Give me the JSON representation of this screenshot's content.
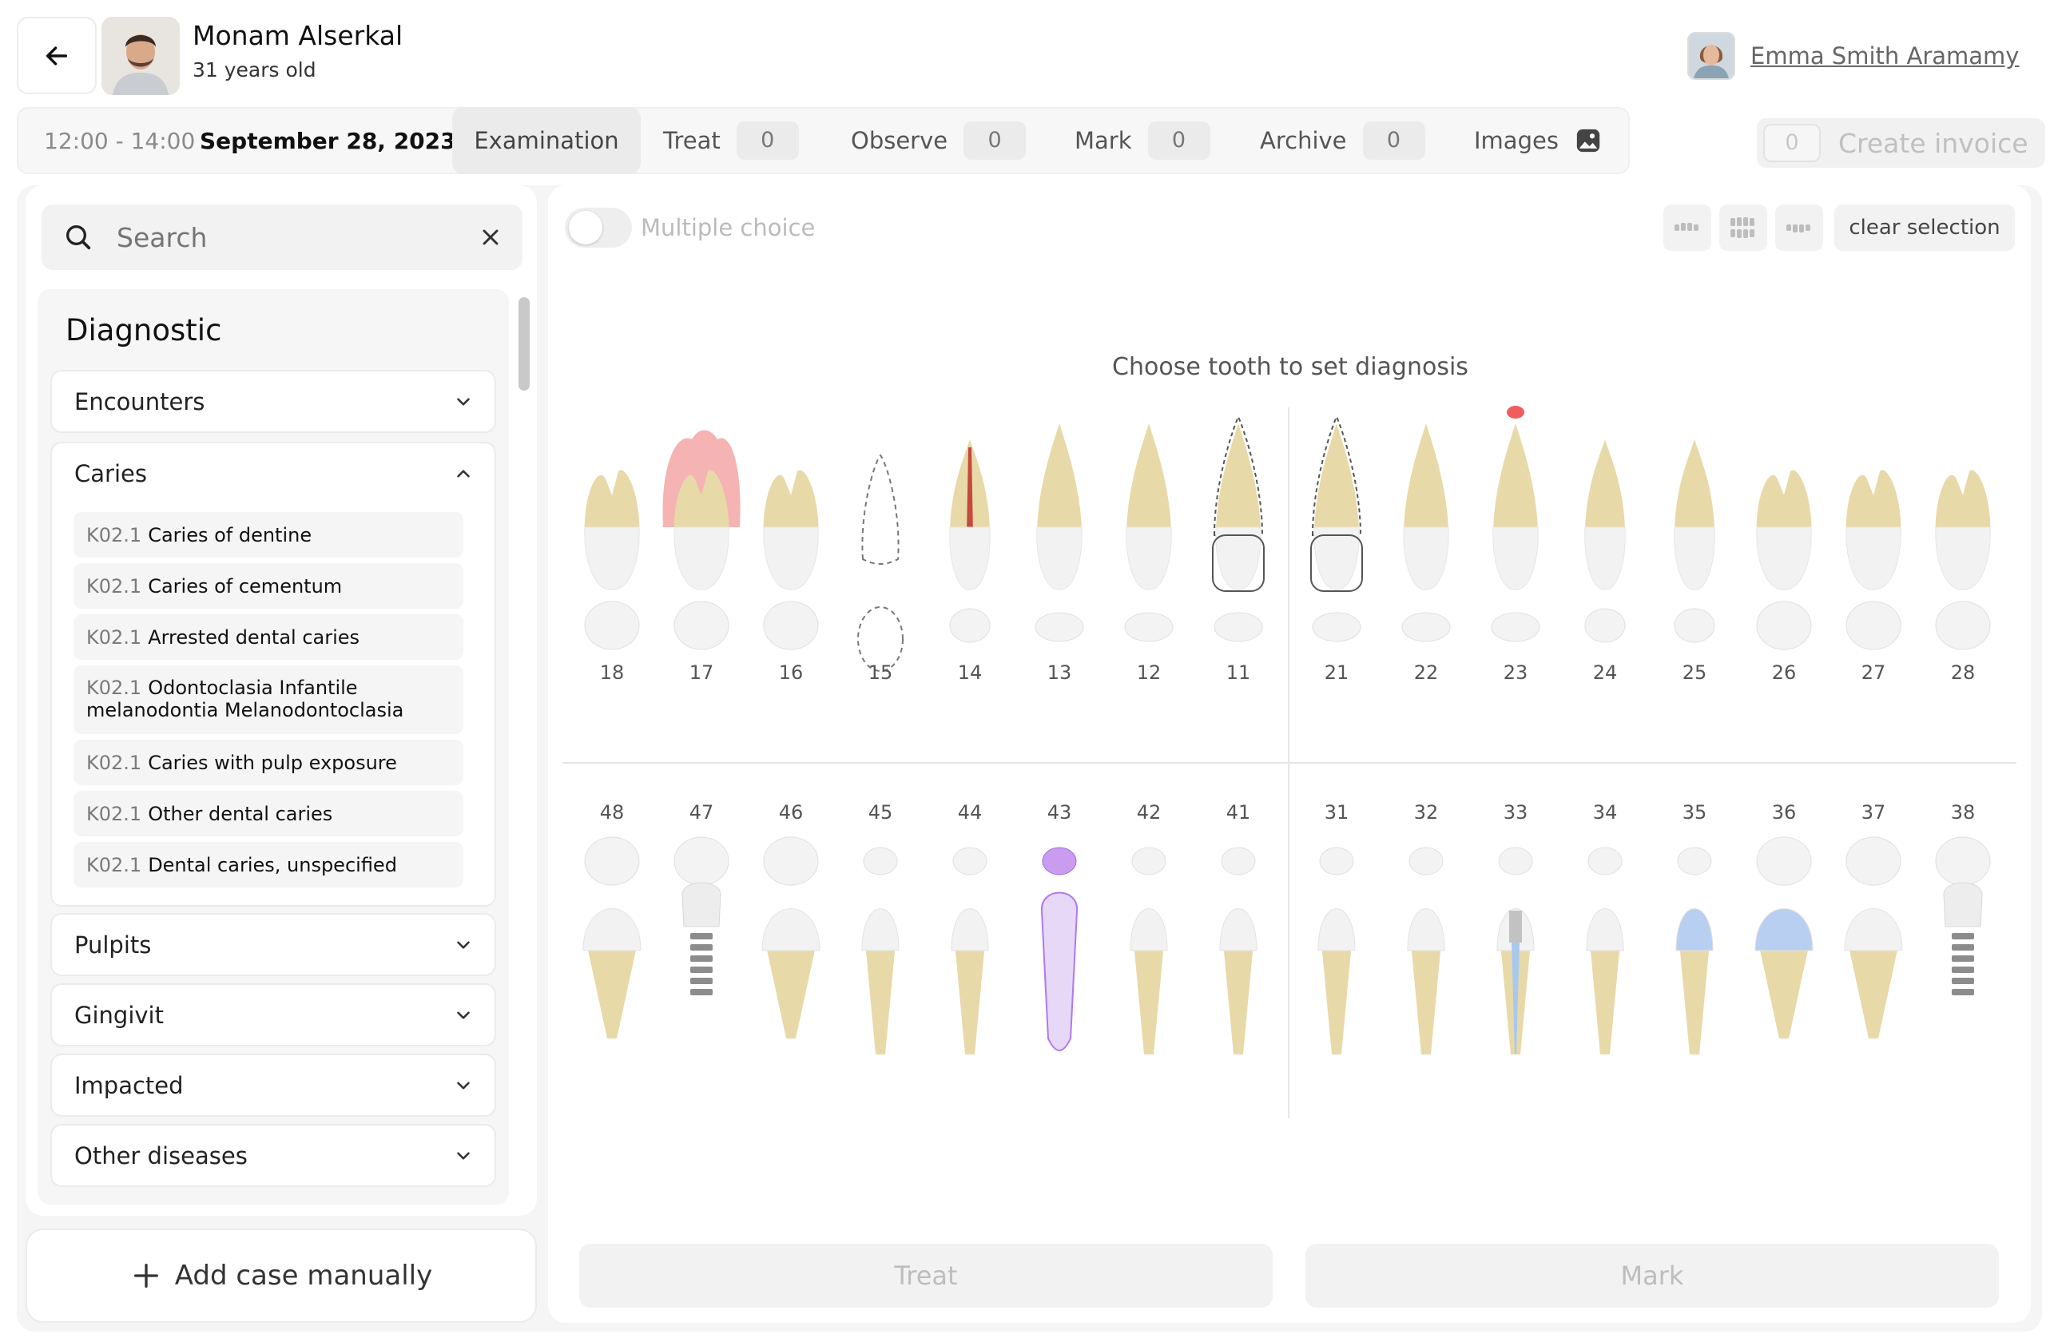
{
  "header": {
    "patient_name": "Monam Alserkal",
    "patient_age": "31 years old",
    "doctor_name": "Emma Smith Aramamy"
  },
  "tabbar": {
    "time": "12:00 - 14:00",
    "date": "September 28, 2023",
    "tabs": [
      {
        "label": "Examination",
        "active": true
      },
      {
        "label": "Treat",
        "count": "0"
      },
      {
        "label": "Observe",
        "count": "0"
      },
      {
        "label": "Mark",
        "count": "0"
      },
      {
        "label": "Archive",
        "count": "0"
      },
      {
        "label": "Images",
        "icon": "image-icon"
      }
    ],
    "invoice": {
      "count": "0",
      "label": "Create invoice"
    }
  },
  "sidebar": {
    "search_placeholder": "Search",
    "title": "Diagnostic",
    "sections": [
      {
        "label": "Encounters",
        "expanded": false
      },
      {
        "label": "Caries",
        "expanded": true,
        "items": [
          {
            "code": "K02.1",
            "label": "Caries of dentine"
          },
          {
            "code": "K02.1",
            "label": "Caries of cementum"
          },
          {
            "code": "K02.1",
            "label": "Arrested dental caries"
          },
          {
            "code": "K02.1",
            "label": "Odontoclasia Infantile melanodontia Melanodontoclasia"
          },
          {
            "code": "K02.1",
            "label": "Caries with pulp exposure"
          },
          {
            "code": "K02.1",
            "label": "Other dental caries"
          },
          {
            "code": "K02.1",
            "label": "Dental caries, unspecified"
          }
        ]
      },
      {
        "label": "Pulpits",
        "expanded": false
      },
      {
        "label": "Gingivit",
        "expanded": false
      },
      {
        "label": "Impacted",
        "expanded": false
      },
      {
        "label": "Other diseases",
        "expanded": false
      }
    ],
    "add_case_label": "Add case manually"
  },
  "chart": {
    "multiple_choice_label": "Multiple choice",
    "multiple_choice_on": false,
    "clear_selection_label": "clear selection",
    "prompt": "Choose tooth to set diagnosis",
    "upper_teeth": [
      "18",
      "17",
      "16",
      "15",
      "14",
      "13",
      "12",
      "11",
      "21",
      "22",
      "23",
      "24",
      "25",
      "26",
      "27",
      "28"
    ],
    "lower_teeth": [
      "48",
      "47",
      "46",
      "45",
      "44",
      "43",
      "42",
      "41",
      "31",
      "32",
      "33",
      "34",
      "35",
      "36",
      "37",
      "38"
    ],
    "marked_teeth": {
      "17": "caries-highlight",
      "15": "missing",
      "14": "root-canal",
      "11": "crown-outline",
      "21": "crown-outline",
      "23": "periapical-lesion",
      "47": "implant",
      "43": "selected",
      "33": "root-canal-post",
      "35": "crown",
      "36": "crown",
      "38": "implant"
    },
    "colors": {
      "root": "#e8d9a8",
      "enamel": "#f2f2f2",
      "caries": "#f4a6a6",
      "selected": "#c99cf0",
      "crown": "#b9cff2",
      "lesion": "#f04b4b"
    }
  },
  "actions": {
    "treat_label": "Treat",
    "mark_label": "Mark"
  }
}
